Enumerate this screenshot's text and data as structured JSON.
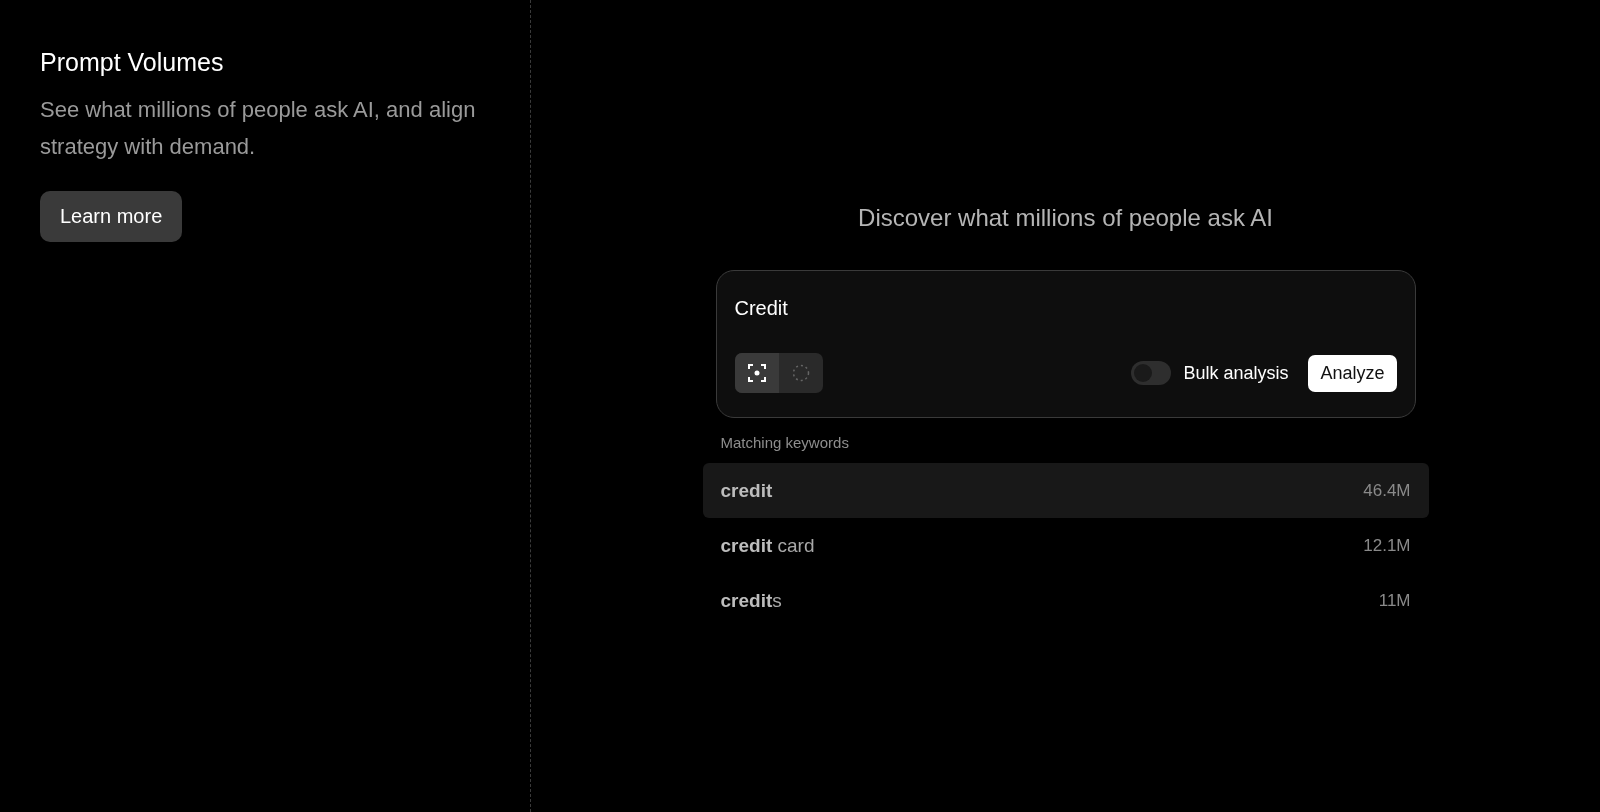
{
  "intro": {
    "title": "Prompt Volumes",
    "description": "See what millions of people ask AI, and align strategy with demand.",
    "button": "Learn more"
  },
  "heading": "Discover what millions of people ask AI",
  "search": {
    "value": "Credit"
  },
  "modes": [
    {
      "kind": "focus",
      "selected": true
    },
    {
      "kind": "scatter",
      "selected": false
    }
  ],
  "bulk_analysis": {
    "label": "Bulk analysis",
    "on": false
  },
  "analyze_button": "Analyze",
  "keywords": {
    "title": "Matching keywords",
    "items": [
      {
        "term": "**credit**",
        "volume": "46.4M",
        "selected": true
      },
      {
        "term": "**credit** card",
        "volume": "12.1M",
        "selected": false
      },
      {
        "term": "**credit**s",
        "volume": "11M",
        "selected": false
      }
    ]
  }
}
